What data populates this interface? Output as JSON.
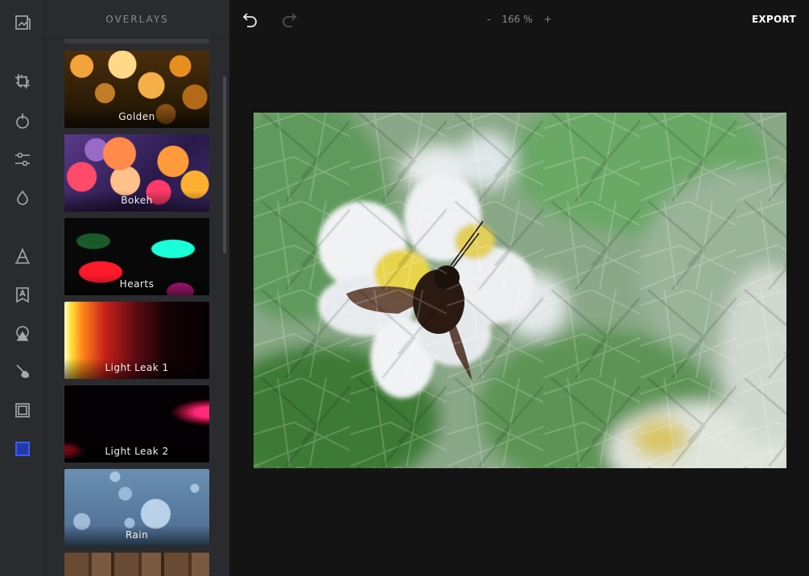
{
  "panel": {
    "title": "OVERLAYS"
  },
  "overlays": [
    {
      "label": "Golden"
    },
    {
      "label": "Bokeh"
    },
    {
      "label": "Hearts"
    },
    {
      "label": "Light Leak 1"
    },
    {
      "label": "Light Leak 2"
    },
    {
      "label": "Rain"
    }
  ],
  "toolbar": {
    "zoom_value": "166 %",
    "zoom_out": "-",
    "zoom_in": "+",
    "export_label": "EXPORT"
  },
  "colors": {
    "accent": "#3d63ff",
    "rail_bg": "#2a2b2e",
    "canvas_bg": "#141414"
  }
}
